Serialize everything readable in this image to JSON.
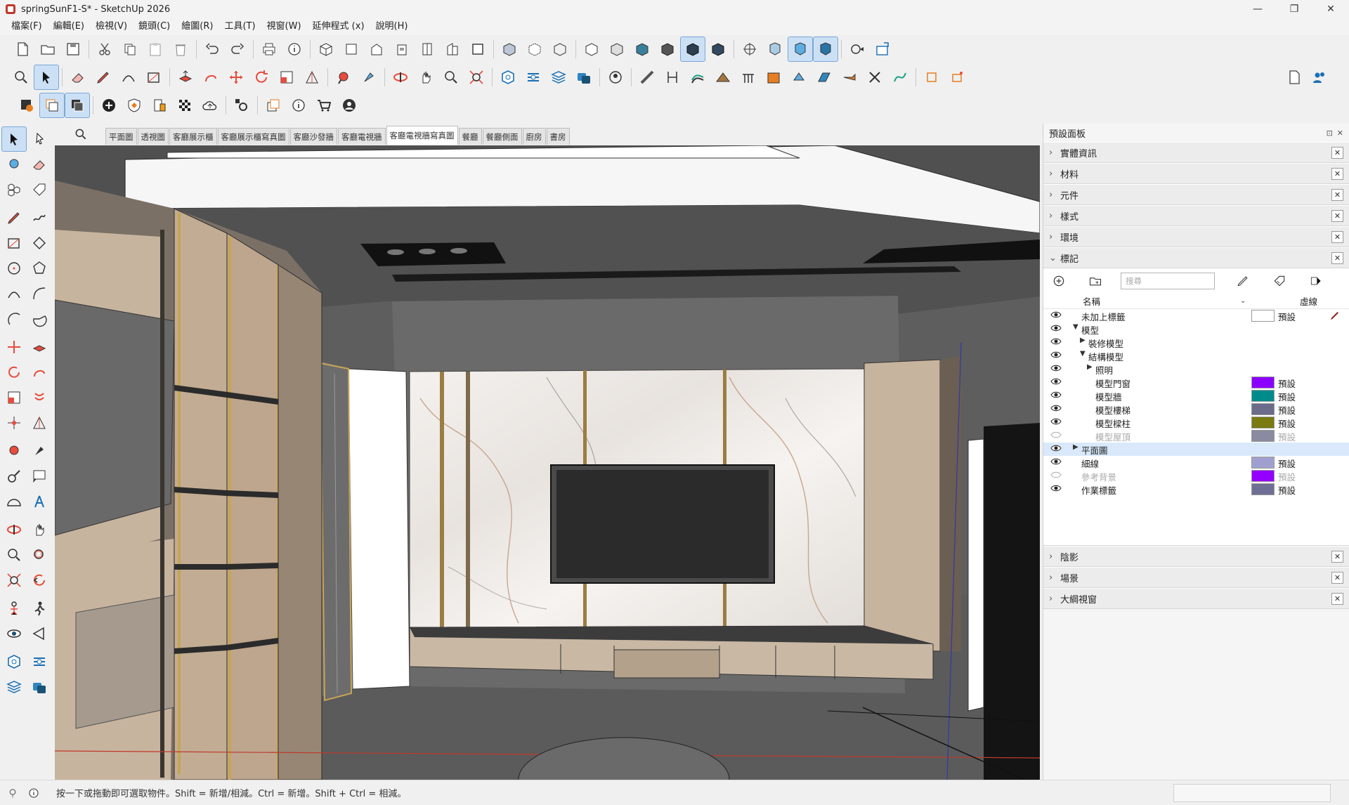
{
  "window": {
    "title": "springSunF1-S* - SketchUp 2026",
    "minimize_glyph": "—",
    "maximize_glyph": "❐",
    "close_glyph": "✕"
  },
  "menu": [
    "檔案(F)",
    "編輯(E)",
    "檢視(V)",
    "鏡頭(C)",
    "繪圖(R)",
    "工具(T)",
    "視窗(W)",
    "延伸程式 (x)",
    "說明(H)"
  ],
  "scene_tabs": {
    "items": [
      "平面圖",
      "透視圖",
      "客廳展示櫃",
      "客廳展示櫃寫真圖",
      "客廳沙發牆",
      "客廳電視牆",
      "客廳電視牆寫真圖",
      "餐廳",
      "餐廳側面",
      "廚房",
      "書房"
    ],
    "active_index": 6
  },
  "tray": {
    "title": "預設面板",
    "pin_glyph": "⊡",
    "close_glyph": "✕",
    "panels_top": [
      "實體資訊",
      "材料",
      "元件",
      "樣式",
      "環境"
    ],
    "tags_panel_title": "標記",
    "panels_bottom": [
      "陰影",
      "場景",
      "大綱視窗"
    ],
    "tags": {
      "search_placeholder": "搜尋",
      "col_name": "名稱",
      "col_dash": "虛線",
      "rows": [
        {
          "name": "未加上標籤",
          "indent": 0,
          "arrow": "",
          "visible": true,
          "color": "#ffffff",
          "dash": "預設",
          "pencil": true
        },
        {
          "name": "模型",
          "indent": 0,
          "arrow": "▼",
          "visible": true,
          "color": "",
          "dash": ""
        },
        {
          "name": "裝修模型",
          "indent": 1,
          "arrow": "▶",
          "visible": true,
          "color": "",
          "dash": ""
        },
        {
          "name": "結構模型",
          "indent": 1,
          "arrow": "▼",
          "visible": true,
          "color": "",
          "dash": ""
        },
        {
          "name": "照明",
          "indent": 2,
          "arrow": "▶",
          "visible": true,
          "color": "",
          "dash": ""
        },
        {
          "name": "模型門窗",
          "indent": 2,
          "arrow": "",
          "visible": true,
          "color": "#8b00ff",
          "dash": "預設"
        },
        {
          "name": "模型牆",
          "indent": 2,
          "arrow": "",
          "visible": true,
          "color": "#008b8b",
          "dash": "預設"
        },
        {
          "name": "模型樓梯",
          "indent": 2,
          "arrow": "",
          "visible": true,
          "color": "#6b6b8a",
          "dash": "預設"
        },
        {
          "name": "模型樑柱",
          "indent": 2,
          "arrow": "",
          "visible": true,
          "color": "#7a7a10",
          "dash": "預設"
        },
        {
          "name": "模型屋頂",
          "indent": 2,
          "arrow": "",
          "visible": false,
          "color": "#8a8aa0",
          "dash": "預設"
        },
        {
          "name": "平面圖",
          "indent": 0,
          "arrow": "▶",
          "visible": true,
          "color": "",
          "dash": "",
          "selected": true
        },
        {
          "name": "細線",
          "indent": 0,
          "arrow": "",
          "visible": true,
          "color": "#a0a0d0",
          "dash": "預設"
        },
        {
          "name": "參考背景",
          "indent": 0,
          "arrow": "",
          "visible": false,
          "color": "#9400ff",
          "dash": "預設"
        },
        {
          "name": "作業標籤",
          "indent": 0,
          "arrow": "",
          "visible": true,
          "color": "#6f6f95",
          "dash": "預設"
        }
      ]
    }
  },
  "status": {
    "text": "按一下或拖動即可選取物件。Shift = 新增/相減。Ctrl = 新增。Shift + Ctrl = 相減。"
  },
  "colors": {
    "viewport_bg": "#5e5e5e",
    "accent": "#cce0f5"
  }
}
